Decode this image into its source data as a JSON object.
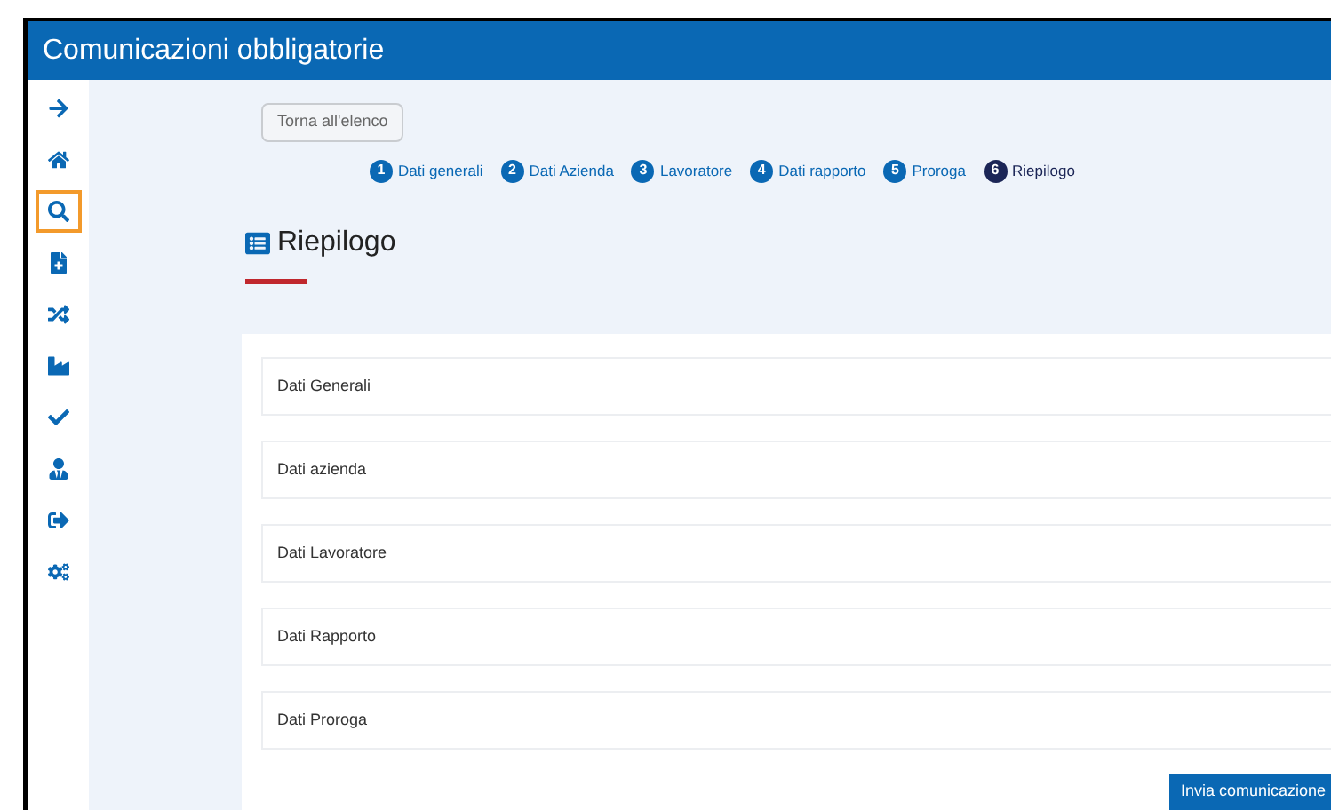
{
  "window": {
    "title": "Comunicazioni obbligatorie"
  },
  "sidebar": {
    "items": [
      {
        "kind": "arrow",
        "selected": false
      },
      {
        "kind": "home",
        "selected": false
      },
      {
        "kind": "search",
        "selected": true
      },
      {
        "kind": "file",
        "selected": false
      },
      {
        "kind": "random",
        "selected": false
      },
      {
        "kind": "industry",
        "selected": false
      },
      {
        "kind": "check",
        "selected": false
      },
      {
        "kind": "user",
        "selected": false
      },
      {
        "kind": "signout",
        "selected": false
      },
      {
        "kind": "cogs",
        "selected": false
      }
    ]
  },
  "back_button": "Torna all'elenco",
  "steps": [
    {
      "number": "1",
      "label": "Dati generali",
      "selected": false
    },
    {
      "number": "2",
      "label": "Dati Azienda",
      "selected": false
    },
    {
      "number": "3",
      "label": "Lavoratore",
      "selected": false
    },
    {
      "number": "4",
      "label": "Dati rapporto",
      "selected": false
    },
    {
      "number": "5",
      "label": "Proroga",
      "selected": false
    },
    {
      "number": "6",
      "label": "Riepilogo",
      "selected": true
    }
  ],
  "heading": "Riepilogo",
  "sections": [
    "Dati Generali",
    "Dati azienda",
    "Dati Lavoratore",
    "Dati Rapporto",
    "Dati Proroga"
  ],
  "submit_button": "Invia comunicazione"
}
